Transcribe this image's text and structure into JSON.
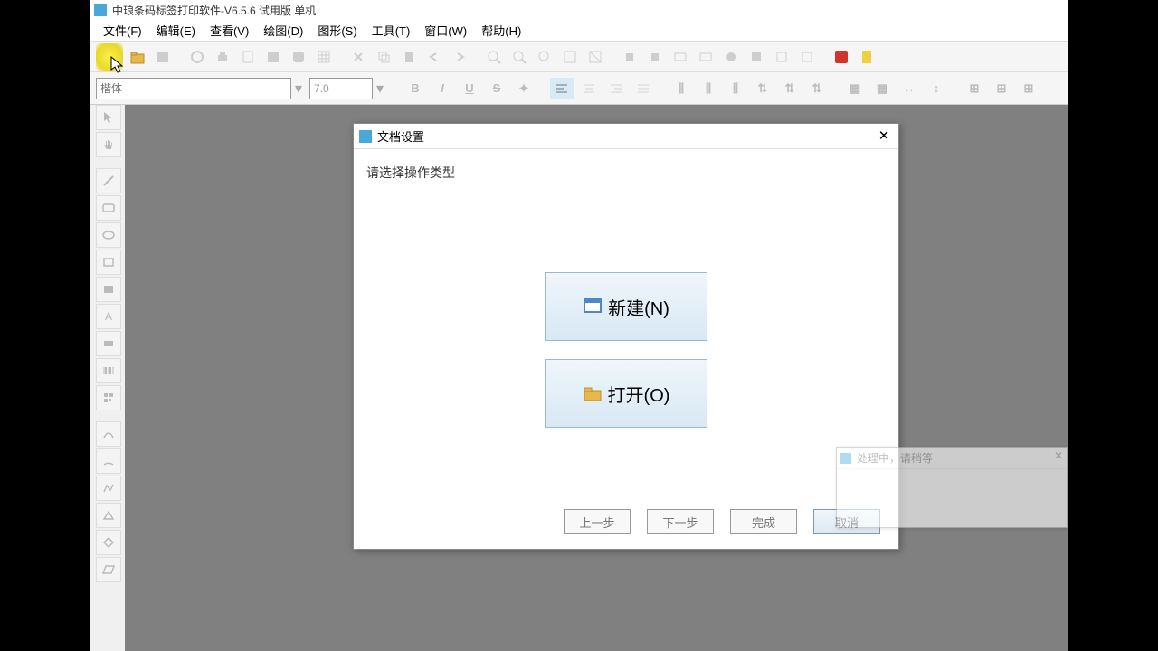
{
  "window": {
    "title": "中琅条码标签打印软件-V6.5.6 试用版 单机"
  },
  "menu": {
    "file": "文件(F)",
    "edit": "编辑(E)",
    "view": "查看(V)",
    "draw": "绘图(D)",
    "shape": "图形(S)",
    "tool": "工具(T)",
    "window": "窗口(W)",
    "help": "帮助(H)"
  },
  "toolbar2": {
    "font_placeholder": "楷体",
    "size_value": "7.0"
  },
  "dialog": {
    "title": "文档设置",
    "prompt": "请选择操作类型",
    "new_label": "新建(N)",
    "open_label": "打开(O)",
    "prev": "上一步",
    "next": "下一步",
    "finish": "完成",
    "cancel": "取消"
  },
  "popup2": {
    "title": "处理中，请稍等"
  }
}
